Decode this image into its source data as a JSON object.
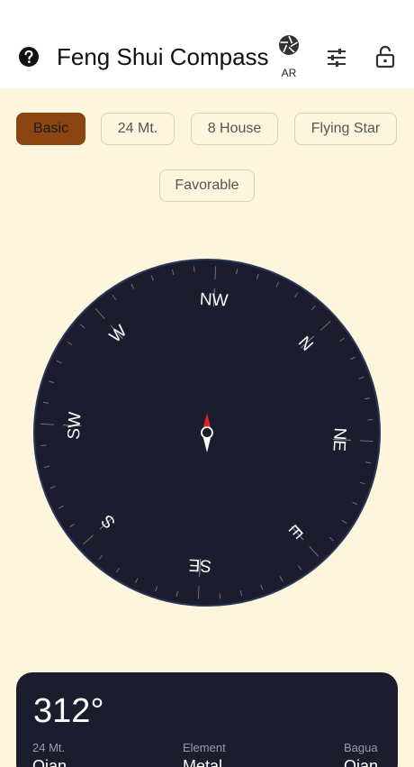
{
  "header": {
    "title": "Feng Shui Compass",
    "ar_label": "AR",
    "icons": [
      "help-icon",
      "camera-shutter-icon",
      "tune-icon",
      "lock-open-icon"
    ]
  },
  "tabs": [
    {
      "label": "Basic",
      "active": true
    },
    {
      "label": "24 Mt.",
      "active": false
    },
    {
      "label": "8 House",
      "active": false
    },
    {
      "label": "Flying Star",
      "active": false
    },
    {
      "label": "Favorable",
      "active": false
    }
  ],
  "compass": {
    "heading_deg": 312,
    "directions": [
      {
        "label": "N",
        "bearing": 0
      },
      {
        "label": "NE",
        "bearing": 45
      },
      {
        "label": "E",
        "bearing": 90
      },
      {
        "label": "SE",
        "bearing": 135
      },
      {
        "label": "S",
        "bearing": 180
      },
      {
        "label": "SW",
        "bearing": 225
      },
      {
        "label": "W",
        "bearing": 270
      },
      {
        "label": "NW",
        "bearing": 315
      }
    ],
    "colors": {
      "dial": "#1b1d2e",
      "needle_north": "#e0231c",
      "needle_south": "#ffffff",
      "tick": "#6e7080"
    }
  },
  "info": {
    "degree": "312°",
    "labels": {
      "mountain": "24 Mt.",
      "element": "Element",
      "bagua": "Bagua"
    },
    "values": {
      "mountain": "Qian",
      "element": "Metal",
      "bagua": "Qian"
    }
  },
  "colors": {
    "accent": "#8b4513",
    "background": "#fdf6dc",
    "card": "#1b1d2e"
  }
}
